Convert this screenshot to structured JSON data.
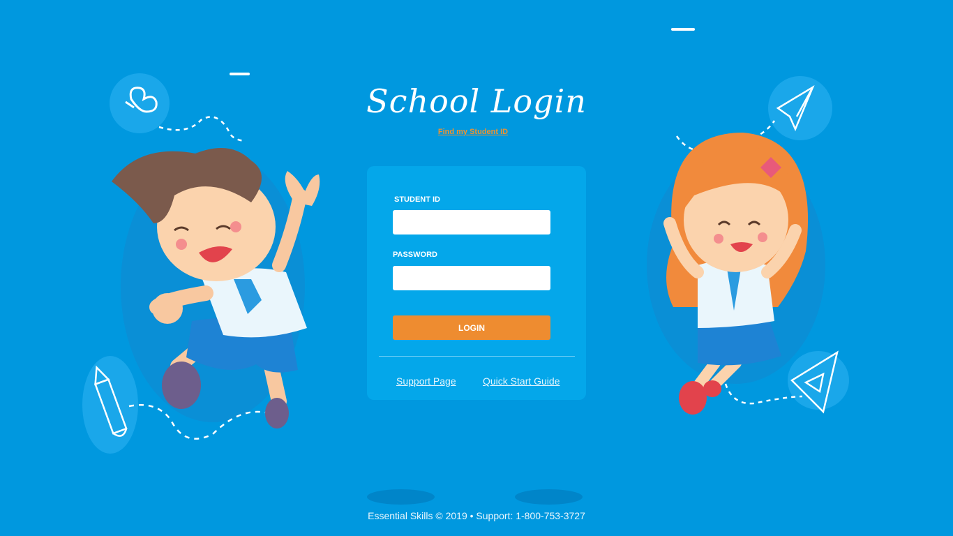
{
  "page": {
    "title": "School Login",
    "find_id_link": "Find my Student ID"
  },
  "form": {
    "student_id_label": "STUDENT ID",
    "student_id_value": "",
    "password_label": "PASSWORD",
    "password_value": "",
    "login_button": "LOGIN"
  },
  "links": {
    "support": " Support Page",
    "quick_start": "Quick Start Guide"
  },
  "footer": {
    "text": "Essential Skills © 2019 • Support: 1-800-753-3727"
  },
  "colors": {
    "background": "#0098df",
    "card": "#04a7ea",
    "accent": "#ee8c30"
  },
  "icons": [
    "butterfly-icon",
    "paper-plane-icon",
    "pencil-icon",
    "triangle-ruler-icon"
  ]
}
